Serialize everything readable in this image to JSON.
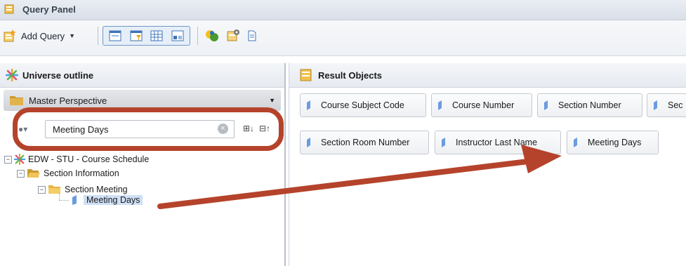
{
  "window": {
    "title": "Query Panel"
  },
  "toolbar": {
    "add_query_label": "Add Query"
  },
  "universe_outline": {
    "header": "Universe outline",
    "perspective": "Master Perspective",
    "search_value": "Meeting Days"
  },
  "tree": {
    "root": "EDW - STU - Course Schedule",
    "folder1": "Section Information",
    "folder2": "Section Meeting",
    "leaf": "Meeting Days"
  },
  "result_objects": {
    "header": "Result Objects",
    "row1": [
      "Course Subject Code",
      "Course Number",
      "Section Number",
      "Sec"
    ],
    "row2": [
      "Section Room Number",
      "Instructor Last Name",
      "Meeting Days"
    ]
  },
  "colors": {
    "annotation": "#b5432b",
    "dimension_icon": "#6b9be0",
    "selection": "#cfe0f5"
  },
  "icons": [
    "query-panel-icon",
    "add-query-icon",
    "universe-icon",
    "perspective-folder-icon",
    "search-options-icon",
    "clear-search-icon",
    "expand-all-icon",
    "collapse-all-icon",
    "dimension-icon",
    "folder-icon"
  ]
}
